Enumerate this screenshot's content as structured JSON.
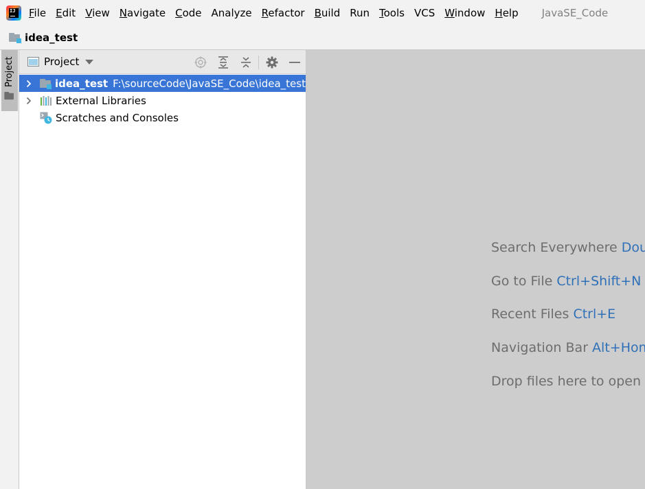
{
  "menubar": {
    "items": [
      {
        "mnemonic": "F",
        "rest": "ile"
      },
      {
        "mnemonic": "E",
        "rest": "dit"
      },
      {
        "mnemonic": "V",
        "rest": "iew"
      },
      {
        "mnemonic": "N",
        "rest": "avigate"
      },
      {
        "mnemonic": "C",
        "rest": "ode"
      },
      {
        "mnemonic": "",
        "rest": "Analyze"
      },
      {
        "mnemonic": "R",
        "rest": "efactor"
      },
      {
        "mnemonic": "B",
        "rest": "uild"
      },
      {
        "mnemonic": "",
        "rest": "Run"
      },
      {
        "mnemonic": "T",
        "rest": "ools"
      },
      {
        "mnemonic": "",
        "rest": "VCS"
      },
      {
        "mnemonic": "W",
        "rest": "indow"
      },
      {
        "mnemonic": "H",
        "rest": "elp"
      }
    ],
    "window_title": "JavaSE_Code"
  },
  "navbar": {
    "project_name": "idea_test"
  },
  "tool_strip": {
    "project_tab_label": "Project"
  },
  "project_panel": {
    "title": "Project",
    "tree": [
      {
        "label": "idea_test",
        "path": "F:\\sourceCode\\JavaSE_Code\\idea_test"
      },
      {
        "label": "External Libraries"
      },
      {
        "label": "Scratches and Consoles"
      }
    ]
  },
  "editor": {
    "hints": [
      {
        "text": "Search Everywhere ",
        "key": "Double Shift"
      },
      {
        "text": "Go to File ",
        "key": "Ctrl+Shift+N"
      },
      {
        "text": "Recent Files ",
        "key": "Ctrl+E"
      },
      {
        "text": "Navigation Bar ",
        "key": "Alt+Home"
      },
      {
        "text": "Drop files here to open",
        "key": ""
      }
    ]
  },
  "colors": {
    "selection": "#3875d6",
    "editor_background": "#cdcdcd",
    "shortcut_key": "#2f70b8",
    "chrome": "#f2f2f2"
  },
  "icons": {
    "app": "intellij-idea-icon",
    "project_folder": "module-folder-icon",
    "libraries": "external-libraries-icon",
    "scratches": "scratches-icon",
    "locate": "locate-icon",
    "expand_all": "expand-all-icon",
    "collapse_all": "collapse-all-icon",
    "settings": "gear-icon",
    "hide": "minimize-icon"
  }
}
